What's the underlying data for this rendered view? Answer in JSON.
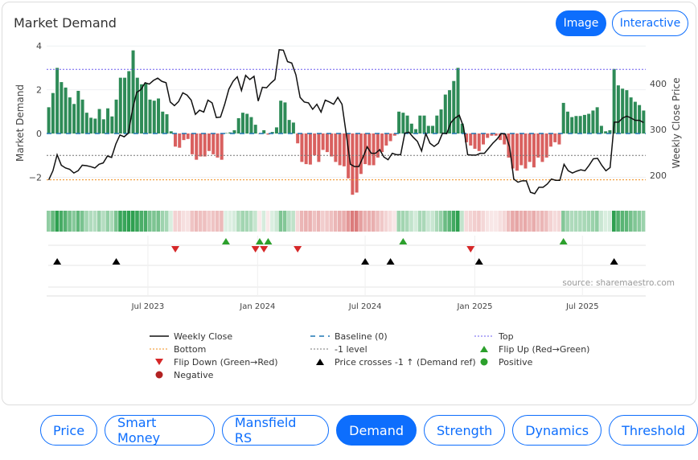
{
  "header": {
    "title": "Market Demand",
    "image_label": "Image",
    "interactive_label": "Interactive"
  },
  "tabs": [
    "Price",
    "Smart Money",
    "Mansfield RS",
    "Demand",
    "Strength",
    "Dynamics",
    "Threshold"
  ],
  "active_tab": "Demand",
  "colors": {
    "accent": "#0d6efd",
    "positive": "#2e8b57",
    "negative": "#d9605f",
    "top": "#6b5cf0",
    "bottom": "#f08c1a",
    "level": "#777777"
  },
  "chart_data": {
    "type": "bar",
    "title": "Market Demand",
    "ylabel": "Market Demand",
    "y2label": "Weekly Close Price",
    "ylim": [
      -3.1,
      4.1
    ],
    "y2lim": [
      150,
      475
    ],
    "yticks": [
      "4",
      "2",
      "0",
      "−2"
    ],
    "ytick_values": [
      4,
      2,
      0,
      -2
    ],
    "y2ticks": [
      "400",
      "300",
      "200"
    ],
    "y2tick_values": [
      400,
      300,
      200
    ],
    "xticks": [
      "Jul 2023",
      "Jan 2024",
      "Jul 2024",
      "Jan 2025",
      "Jul 2025"
    ],
    "xtick_weeks": [
      24,
      50,
      75.5,
      101.5,
      127
    ],
    "levels": {
      "top": 2.93,
      "baseline": 0,
      "minus_one": -1,
      "bottom": -2.12
    },
    "demand": [
      1.2,
      1.85,
      3.0,
      2.35,
      2.1,
      1.65,
      1.35,
      1.95,
      1.55,
      0.95,
      0.72,
      0.68,
      1.12,
      0.65,
      1.15,
      0.78,
      1.55,
      2.55,
      2.55,
      2.85,
      3.8,
      2.55,
      2.25,
      2.3,
      1.55,
      1.5,
      1.6,
      1.0,
      0.88,
      0.1,
      -0.6,
      -0.65,
      -0.3,
      -0.25,
      -0.95,
      -1.2,
      -1.05,
      -1.05,
      -0.8,
      -0.95,
      -1.1,
      -1.2,
      0.02,
      0.05,
      0.15,
      0.7,
      0.95,
      0.9,
      0.75,
      0.4,
      -0.02,
      0.15,
      -0.05,
      0.07,
      0.28,
      1.5,
      1.42,
      0.62,
      0.5,
      -0.45,
      -1.3,
      -1.4,
      -1.42,
      -1.0,
      -1.3,
      -0.75,
      -0.85,
      -1.05,
      -1.3,
      -1.45,
      -1.5,
      -2.05,
      -2.8,
      -2.7,
      -1.85,
      -1.4,
      -1.45,
      -1.45,
      -1.1,
      -0.85,
      -0.55,
      -0.35,
      -0.1,
      1.0,
      0.95,
      0.82,
      0.45,
      0.2,
      0.82,
      0.82,
      0.35,
      0.35,
      0.82,
      1.1,
      1.78,
      1.98,
      2.4,
      3.0,
      0.45,
      -0.4,
      -0.55,
      -0.7,
      -0.8,
      -0.5,
      -0.2,
      -0.1,
      -0.1,
      -0.3,
      -0.5,
      -1.1,
      -1.6,
      -1.7,
      -1.45,
      -1.6,
      -1.3,
      -1.55,
      -1.1,
      -1.3,
      -1.1,
      -0.6,
      -0.4,
      -0.5,
      1.4,
      1.0,
      0.75,
      0.8,
      0.8,
      0.85,
      0.9,
      1.05,
      1.2,
      0.35,
      0.1,
      0.15,
      2.95,
      2.2,
      2.05,
      1.98,
      1.65,
      1.45,
      1.3,
      1.05
    ],
    "price": [
      190,
      210,
      245,
      222,
      216,
      213,
      205,
      210,
      222,
      221,
      219,
      216,
      224,
      227,
      242,
      239,
      268,
      288,
      284,
      292,
      344,
      381,
      387,
      402,
      399,
      407,
      412,
      405,
      402,
      360,
      352,
      361,
      380,
      375,
      364,
      333,
      342,
      338,
      364,
      358,
      326,
      327,
      355,
      388,
      405,
      415,
      385,
      418,
      409,
      416,
      362,
      392,
      391,
      401,
      409,
      474,
      473,
      448,
      445,
      419,
      370,
      360,
      358,
      344,
      355,
      338,
      364,
      360,
      355,
      370,
      355,
      291,
      224,
      219,
      219,
      239,
      262,
      248,
      248,
      256,
      240,
      234,
      248,
      245,
      245,
      292,
      294,
      283,
      274,
      253,
      291,
      270,
      263,
      270,
      292,
      291,
      315,
      325,
      331,
      306,
      245,
      244,
      244,
      248,
      248,
      259,
      270,
      279,
      291,
      290,
      262,
      192,
      185,
      188,
      188,
      163,
      160,
      174,
      174,
      181,
      192,
      189,
      189,
      224,
      210,
      205,
      209,
      212,
      210,
      222,
      236,
      237,
      222,
      210,
      217,
      316,
      316,
      325,
      329,
      325,
      320,
      320,
      315
    ],
    "flip_up_weeks": [
      42,
      50,
      52,
      84,
      122
    ],
    "flip_down_weeks": [
      30,
      49,
      51,
      59,
      100
    ],
    "price_cross_weeks": [
      2,
      16,
      75,
      81,
      102,
      134
    ],
    "source": "source: sharemaestro.com",
    "legend": [
      "Weekly Close",
      "Baseline (0)",
      "Top",
      "Bottom",
      "-1 level",
      "Flip Up (Red→Green)",
      "Flip Down (Green→Red)",
      "Price crosses -1 ↑ (Demand ref)",
      "Positive",
      "Negative"
    ]
  }
}
